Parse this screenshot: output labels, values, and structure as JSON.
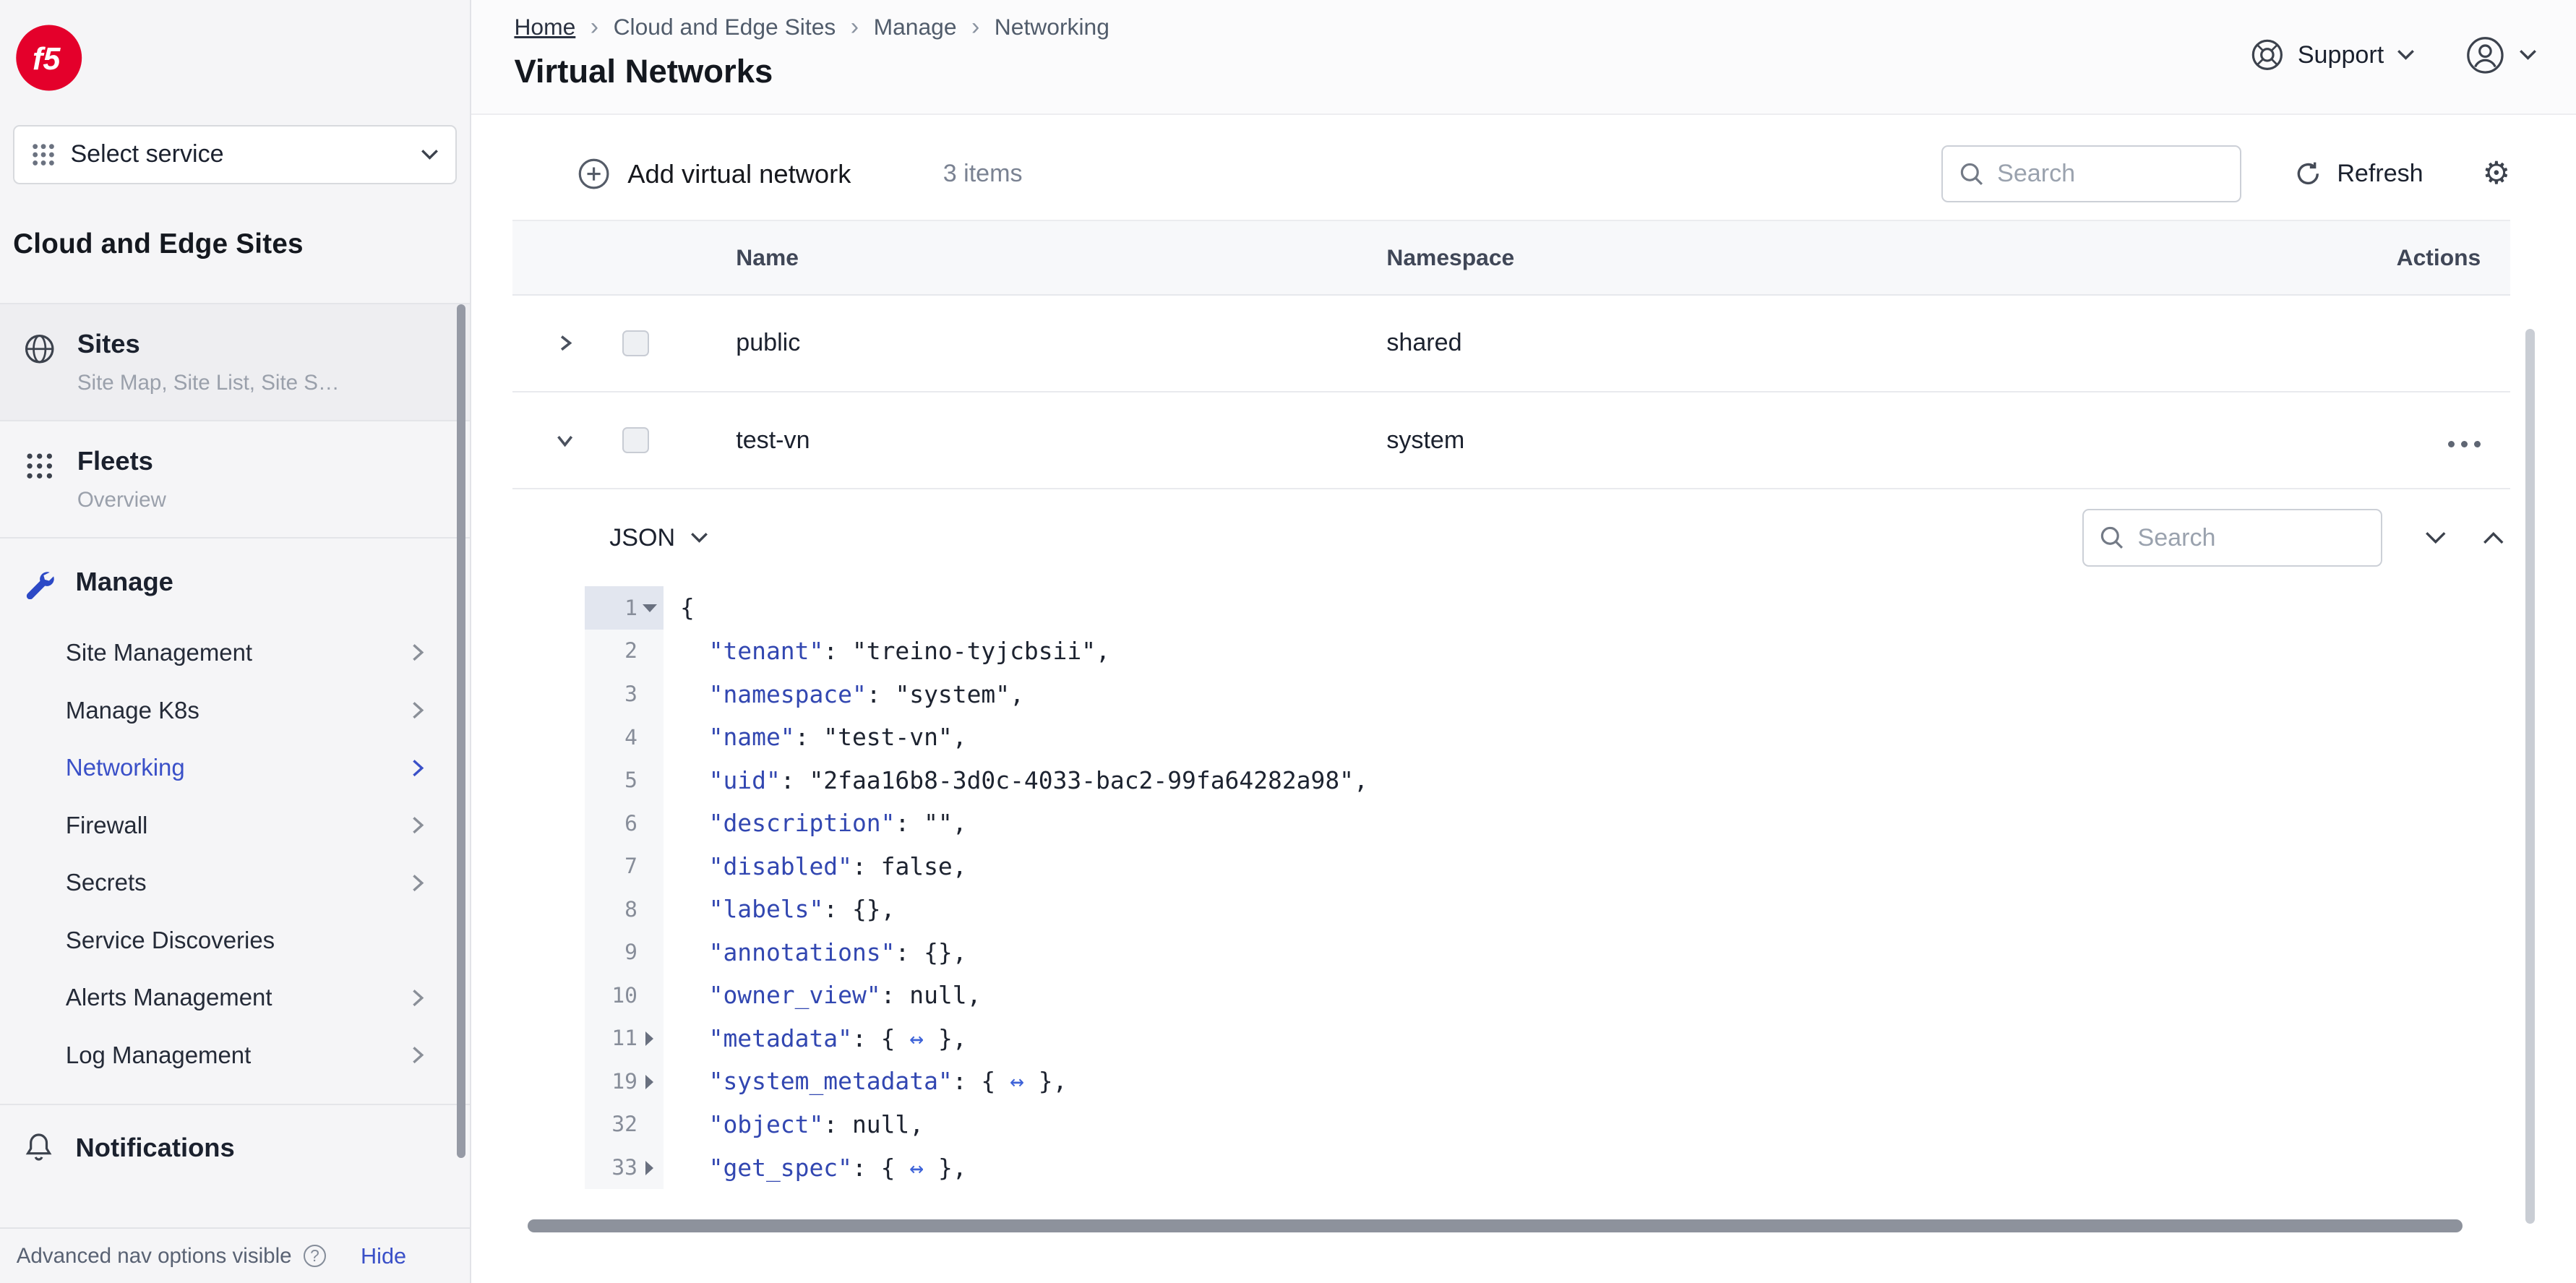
{
  "colors": {
    "brand_red": "#e4002b",
    "accent_blue": "#3a50c8",
    "key_blue": "#3247b1"
  },
  "sidebar": {
    "logo_text": "f5",
    "service_selector_label": "Select service",
    "section_title": "Cloud and Edge Sites",
    "sites": {
      "label": "Sites",
      "subtitle": "Site Map, Site List, Site S…"
    },
    "fleets": {
      "label": "Fleets",
      "subtitle": "Overview"
    },
    "manage_label": "Manage",
    "manage_items": [
      {
        "label": "Site Management",
        "chevron": true
      },
      {
        "label": "Manage K8s",
        "chevron": true
      },
      {
        "label": "Networking",
        "chevron": true,
        "active": true
      },
      {
        "label": "Firewall",
        "chevron": true
      },
      {
        "label": "Secrets",
        "chevron": true
      },
      {
        "label": "Service Discoveries",
        "chevron": false
      },
      {
        "label": "Alerts Management",
        "chevron": true
      },
      {
        "label": "Log Management",
        "chevron": true
      }
    ],
    "notifications_label": "Notifications",
    "footer": {
      "text": "Advanced nav options visible",
      "hide_label": "Hide"
    }
  },
  "header": {
    "breadcrumbs": [
      "Home",
      "Cloud and Edge Sites",
      "Manage",
      "Networking"
    ],
    "title": "Virtual Networks",
    "support_label": "Support"
  },
  "toolbar": {
    "add_label": "Add virtual network",
    "items_count": "3 items",
    "search_placeholder": "Search",
    "refresh_label": "Refresh"
  },
  "table": {
    "columns": {
      "name": "Name",
      "namespace": "Namespace",
      "actions": "Actions"
    },
    "rows": [
      {
        "name": "public",
        "namespace": "shared"
      },
      {
        "name": "test-vn",
        "namespace": "system"
      }
    ]
  },
  "json_panel": {
    "mode_label": "JSON",
    "search_placeholder": "Search",
    "lines": [
      {
        "num": "1",
        "fold": "open",
        "active": true,
        "tokens": [
          [
            "",
            "{"
          ]
        ]
      },
      {
        "num": "2",
        "tokens": [
          [
            "",
            "  "
          ],
          [
            "k",
            "\"tenant\""
          ],
          [
            "",
            ": \"treino-tyjcbsii\","
          ]
        ]
      },
      {
        "num": "3",
        "tokens": [
          [
            "",
            "  "
          ],
          [
            "k",
            "\"namespace\""
          ],
          [
            "",
            ": \"system\","
          ]
        ]
      },
      {
        "num": "4",
        "tokens": [
          [
            "",
            "  "
          ],
          [
            "k",
            "\"name\""
          ],
          [
            "",
            ": \"test-vn\","
          ]
        ]
      },
      {
        "num": "5",
        "tokens": [
          [
            "",
            "  "
          ],
          [
            "k",
            "\"uid\""
          ],
          [
            "",
            ": \"2faa16b8-3d0c-4033-bac2-99fa64282a98\","
          ]
        ]
      },
      {
        "num": "6",
        "tokens": [
          [
            "",
            "  "
          ],
          [
            "k",
            "\"description\""
          ],
          [
            "",
            ": \"\","
          ]
        ]
      },
      {
        "num": "7",
        "tokens": [
          [
            "",
            "  "
          ],
          [
            "k",
            "\"disabled\""
          ],
          [
            "",
            ": false,"
          ]
        ]
      },
      {
        "num": "8",
        "tokens": [
          [
            "",
            "  "
          ],
          [
            "k",
            "\"labels\""
          ],
          [
            "",
            ": {},"
          ]
        ]
      },
      {
        "num": "9",
        "tokens": [
          [
            "",
            "  "
          ],
          [
            "k",
            "\"annotations\""
          ],
          [
            "",
            ": {},"
          ]
        ]
      },
      {
        "num": "10",
        "tokens": [
          [
            "",
            "  "
          ],
          [
            "k",
            "\"owner_view\""
          ],
          [
            "",
            ": null,"
          ]
        ]
      },
      {
        "num": "11",
        "fold": "closed",
        "tokens": [
          [
            "",
            "  "
          ],
          [
            "k",
            "\"metadata\""
          ],
          [
            "",
            ": { "
          ],
          [
            "arr",
            "↔"
          ],
          [
            "",
            " },"
          ]
        ]
      },
      {
        "num": "19",
        "fold": "closed",
        "tokens": [
          [
            "",
            "  "
          ],
          [
            "k",
            "\"system_metadata\""
          ],
          [
            "",
            ": { "
          ],
          [
            "arr",
            "↔"
          ],
          [
            "",
            " },"
          ]
        ]
      },
      {
        "num": "32",
        "tokens": [
          [
            "",
            "  "
          ],
          [
            "k",
            "\"object\""
          ],
          [
            "",
            ": null,"
          ]
        ]
      },
      {
        "num": "33",
        "fold": "closed",
        "tokens": [
          [
            "",
            "  "
          ],
          [
            "k",
            "\"get_spec\""
          ],
          [
            "",
            ": { "
          ],
          [
            "arr",
            "↔"
          ],
          [
            "",
            " },"
          ]
        ]
      }
    ]
  }
}
